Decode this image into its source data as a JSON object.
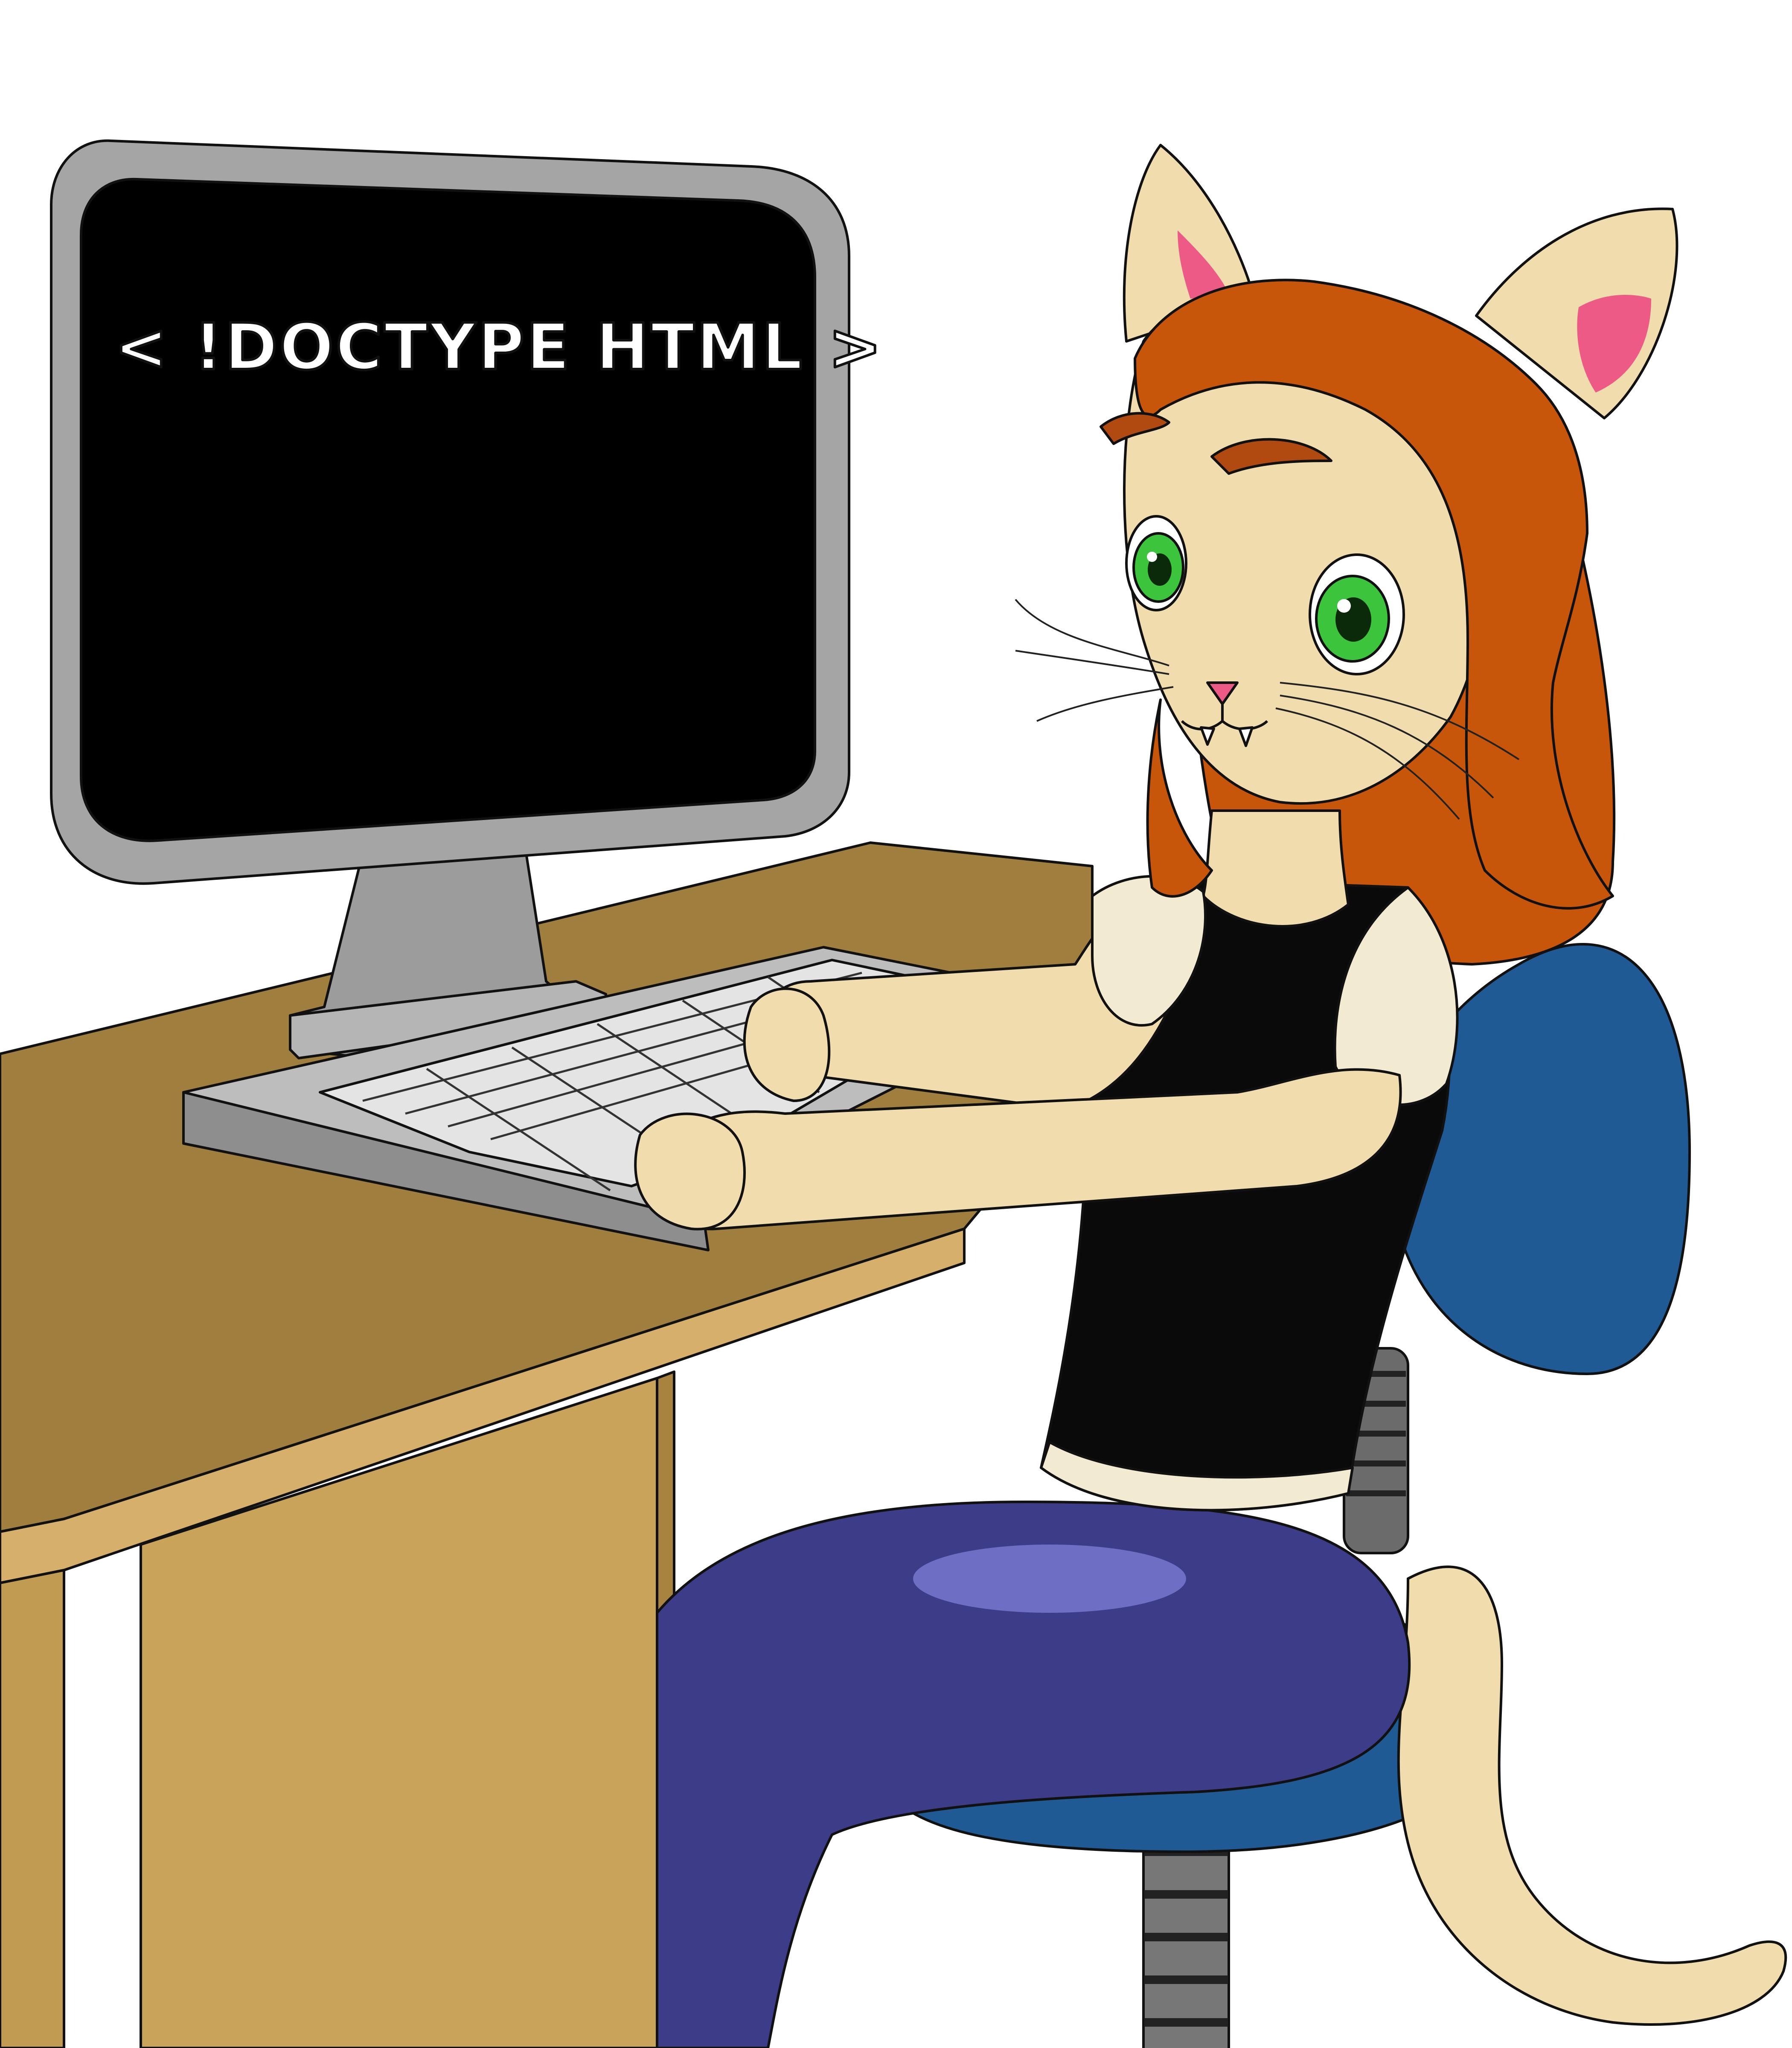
{
  "monitor": {
    "screen_text": "< !DOCTYPE HTML >"
  },
  "colors": {
    "background": "#ffffff",
    "screen": "#000000",
    "bezel": "#9a9a9a",
    "desk_top": "#a07f3e",
    "desk_front": "#c9a35a",
    "fur": "#f1dcae",
    "hair": "#c8560a",
    "eyes": "#3cc43c",
    "shirt": "#0a0a0a",
    "sleeve": "#f3ead2",
    "pants": "#3c3c88",
    "chair": "#1f5a94"
  }
}
